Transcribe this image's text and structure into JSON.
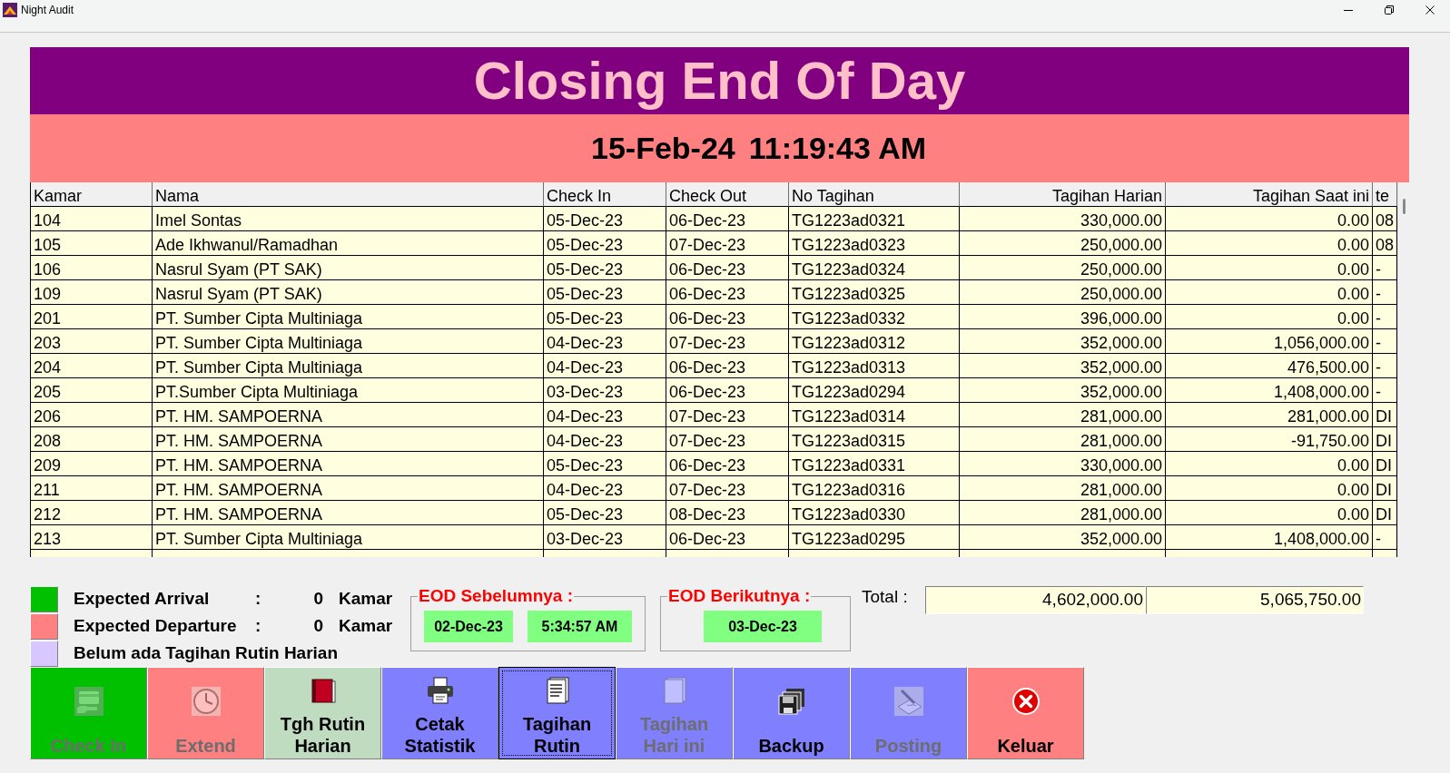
{
  "window": {
    "title": "Night Audit"
  },
  "banner": {
    "title": "Closing End Of Day",
    "date": "15-Feb-24",
    "time": "11:19:43 AM"
  },
  "table": {
    "columns": [
      {
        "label": "Kamar",
        "kind": "text"
      },
      {
        "label": "Nama",
        "kind": "text"
      },
      {
        "label": "Check In",
        "kind": "text"
      },
      {
        "label": "Check Out",
        "kind": "text"
      },
      {
        "label": "No Tagihan",
        "kind": "text"
      },
      {
        "label": "Tagihan Harian",
        "kind": "amount"
      },
      {
        "label": "Tagihan Saat ini",
        "kind": "amount"
      },
      {
        "label": "te",
        "kind": "text"
      }
    ],
    "rows": [
      [
        "104",
        "Imel Sontas",
        "05-Dec-23",
        "06-Dec-23",
        "TG1223ad0321",
        "330,000.00",
        "0.00",
        "08"
      ],
      [
        "105",
        "Ade Ikhwanul/Ramadhan",
        "05-Dec-23",
        "07-Dec-23",
        "TG1223ad0323",
        "250,000.00",
        "0.00",
        "08"
      ],
      [
        "106",
        "Nasrul Syam (PT SAK)",
        "05-Dec-23",
        "06-Dec-23",
        "TG1223ad0324",
        "250,000.00",
        "0.00",
        "-"
      ],
      [
        "109",
        "Nasrul Syam (PT SAK)",
        "05-Dec-23",
        "06-Dec-23",
        "TG1223ad0325",
        "250,000.00",
        "0.00",
        "-"
      ],
      [
        "201",
        "PT. Sumber Cipta Multiniaga",
        "05-Dec-23",
        "06-Dec-23",
        "TG1223ad0332",
        "396,000.00",
        "0.00",
        "-"
      ],
      [
        "203",
        "PT. Sumber Cipta Multiniaga",
        "04-Dec-23",
        "07-Dec-23",
        "TG1223ad0312",
        "352,000.00",
        "1,056,000.00",
        "-"
      ],
      [
        "204",
        "PT. Sumber Cipta Multiniaga",
        "04-Dec-23",
        "06-Dec-23",
        "TG1223ad0313",
        "352,000.00",
        "476,500.00",
        "-"
      ],
      [
        "205",
        "PT.Sumber Cipta Multiniaga",
        "03-Dec-23",
        "06-Dec-23",
        "TG1223ad0294",
        "352,000.00",
        "1,408,000.00",
        "-"
      ],
      [
        "206",
        "PT. HM. SAMPOERNA",
        "04-Dec-23",
        "07-Dec-23",
        "TG1223ad0314",
        "281,000.00",
        "281,000.00",
        "DI"
      ],
      [
        "208",
        "PT. HM. SAMPOERNA",
        "04-Dec-23",
        "07-Dec-23",
        "TG1223ad0315",
        "281,000.00",
        "-91,750.00",
        "DI"
      ],
      [
        "209",
        "PT. HM. SAMPOERNA",
        "05-Dec-23",
        "06-Dec-23",
        "TG1223ad0331",
        "330,000.00",
        "0.00",
        "DI"
      ],
      [
        "211",
        "PT. HM. SAMPOERNA",
        "04-Dec-23",
        "07-Dec-23",
        "TG1223ad0316",
        "281,000.00",
        "0.00",
        "DI"
      ],
      [
        "212",
        "PT. HM. SAMPOERNA",
        "05-Dec-23",
        "08-Dec-23",
        "TG1223ad0330",
        "281,000.00",
        "0.00",
        "DI"
      ],
      [
        "213",
        "PT. Sumber Cipta Multiniaga",
        "03-Dec-23",
        "06-Dec-23",
        "TG1223ad0295",
        "352,000.00",
        "1,408,000.00",
        "-"
      ]
    ]
  },
  "legend": [
    {
      "color": "#00c000",
      "label": "Expected Arrival",
      "colon": ":",
      "count": "0",
      "unit": "Kamar"
    },
    {
      "color": "#ff8080",
      "label": "Expected Departure",
      "colon": ":",
      "count": "0",
      "unit": "Kamar"
    },
    {
      "color": "#d8c8ff",
      "label": "Belum ada Tagihan Rutin Harian"
    }
  ],
  "eod_previous": {
    "title": "EOD Sebelumnya :",
    "date": "02-Dec-23",
    "time": "5:34:57 AM"
  },
  "eod_next": {
    "title": "EOD Berikutnya :",
    "date": "03-Dec-23"
  },
  "totals": {
    "label": "Total :",
    "values": [
      "4,602,000.00",
      "5,065,750.00"
    ]
  },
  "buttons": [
    {
      "label": "Check In",
      "kind": "card",
      "color": "#00c000",
      "disabled": true,
      "focused": false
    },
    {
      "label": "Extend",
      "kind": "clock",
      "color": "#ff8080",
      "disabled": true,
      "focused": false
    },
    {
      "label": "Tgh Rutin\nHarian",
      "kind": "book",
      "color": "#c0dcc0",
      "disabled": false,
      "focused": false
    },
    {
      "label": "Cetak\nStatistik",
      "kind": "printer",
      "color": "#8080ff",
      "disabled": false,
      "focused": false
    },
    {
      "label": "Tagihan\nRutin",
      "kind": "documents",
      "color": "#8080ff",
      "disabled": false,
      "focused": true
    },
    {
      "label": "Tagihan\nHari ini",
      "kind": "document",
      "color": "#8080ff",
      "disabled": true,
      "focused": false
    },
    {
      "label": "Backup",
      "kind": "floppy",
      "color": "#8080ff",
      "disabled": false,
      "focused": false
    },
    {
      "label": "Posting",
      "kind": "pen",
      "color": "#8080ff",
      "disabled": true,
      "focused": false
    },
    {
      "label": "Keluar",
      "kind": "close",
      "color": "#ff8080",
      "disabled": false,
      "focused": false
    }
  ]
}
